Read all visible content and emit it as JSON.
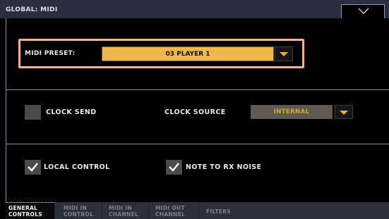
{
  "header": {
    "title": "GLOBAL: MIDI"
  },
  "midi_preset": {
    "label": "MIDI PRESET:",
    "value": "03 PLAYER 1"
  },
  "clock": {
    "clock_send_label": "CLOCK SEND",
    "clock_send_checked": false,
    "clock_source_label": "CLOCK SOURCE",
    "clock_source_value": "INTERNAL"
  },
  "controls": {
    "local_control_label": "LOCAL CONTROL",
    "local_control_checked": true,
    "note_to_rx_noise_label": "NOTE TO RX NOISE",
    "note_to_rx_noise_checked": true
  },
  "tabs": [
    {
      "line1": "GENERAL",
      "line2": "CONTROLS",
      "active": true
    },
    {
      "line1": "MIDI IN",
      "line2": "CONTROL",
      "active": false
    },
    {
      "line1": "MIDI IN",
      "line2": "CHANNEL",
      "active": false
    },
    {
      "line1": "MIDI OUT",
      "line2": "CHANNEL",
      "active": false
    },
    {
      "line1": "FILTERS",
      "line2": "",
      "active": false
    }
  ],
  "colors": {
    "accent": "#f0b84a",
    "highlight_frame": "#f2b286",
    "arrow": "#f3b31c",
    "titlebar": "#2a2f3f",
    "tabbar": "#2b303d"
  },
  "icons": {
    "menu": "chevron-down-icon",
    "dropdown": "triangle-down-icon",
    "checked": "checkmark-icon"
  }
}
